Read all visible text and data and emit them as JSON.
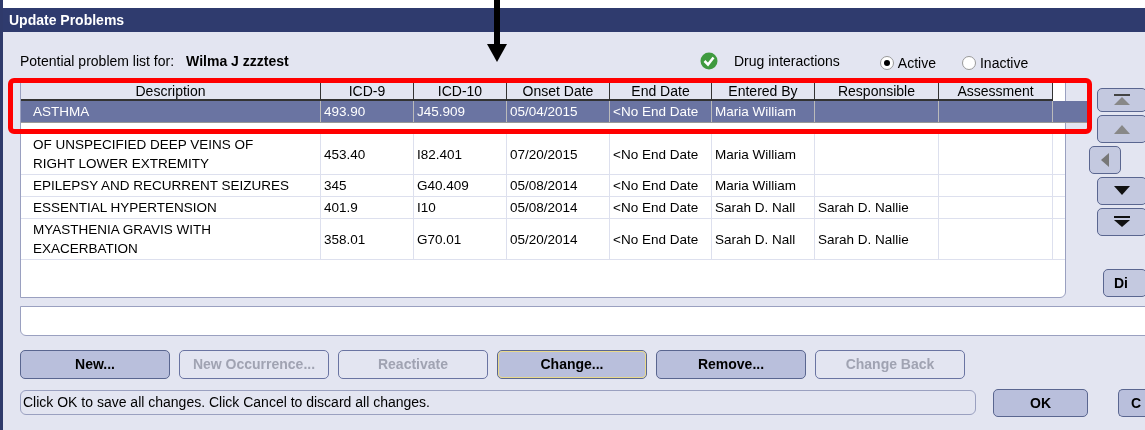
{
  "window": {
    "title": "Update Problems"
  },
  "patient": {
    "label": "Potential problem list for:",
    "name": "Wilma J zzztest"
  },
  "drug_interactions": {
    "label": "Drug interactions",
    "checked": true
  },
  "filter": [
    {
      "label": "Active",
      "selected": true
    },
    {
      "label": "Inactive",
      "selected": false
    }
  ],
  "table": {
    "columns": [
      "Description",
      "ICD-9",
      "ICD-10",
      "Onset Date",
      "End Date",
      "Entered By",
      "Responsible",
      "Assessment"
    ],
    "rows": [
      {
        "selected": true,
        "cells": [
          "ASTHMA",
          "493.90",
          "J45.909",
          "05/04/2015",
          "<No End Date",
          "Maria William",
          "",
          ""
        ]
      },
      {
        "selected": false,
        "cells": [
          "OF UNSPECIFIED DEEP VEINS OF RIGHT LOWER EXTREMITY",
          "453.40",
          "I82.401",
          "07/20/2015",
          "<No End Date",
          "Maria William",
          "",
          ""
        ]
      },
      {
        "selected": false,
        "cells": [
          "EPILEPSY AND RECURRENT SEIZURES",
          "345",
          "G40.409",
          "05/08/2014",
          "<No End Date",
          "Maria William",
          "",
          ""
        ]
      },
      {
        "selected": false,
        "cells": [
          "ESSENTIAL HYPERTENSION",
          "401.9",
          "I10",
          "05/08/2014",
          "<No End Date",
          "Sarah D. Nall",
          "Sarah D. Nallie",
          ""
        ]
      },
      {
        "selected": false,
        "cells": [
          "MYASTHENIA GRAVIS WITH EXACERBATION",
          "358.01",
          "G70.01",
          "05/20/2014",
          "<No End Date",
          "Sarah D. Nall",
          "Sarah D. Nallie",
          ""
        ]
      }
    ]
  },
  "side_buttons": [
    {
      "kind": "top"
    },
    {
      "kind": "up"
    },
    {
      "kind": "left"
    },
    {
      "kind": "down"
    },
    {
      "kind": "bottom"
    },
    {
      "kind": "text",
      "label": "Di"
    }
  ],
  "actions": [
    {
      "label": "New...",
      "disabled": false,
      "focused": false
    },
    {
      "label": "New Occurrence...",
      "disabled": true,
      "focused": false
    },
    {
      "label": "Reactivate",
      "disabled": true,
      "focused": false
    },
    {
      "label": "Change...",
      "disabled": false,
      "focused": true
    },
    {
      "label": "Remove...",
      "disabled": false,
      "focused": false
    },
    {
      "label": "Change Back",
      "disabled": true,
      "focused": false
    }
  ],
  "status": "Click OK to save all changes. Click Cancel to discard all changes.",
  "dialog_buttons": [
    {
      "label": "OK"
    },
    {
      "label": "C"
    }
  ]
}
